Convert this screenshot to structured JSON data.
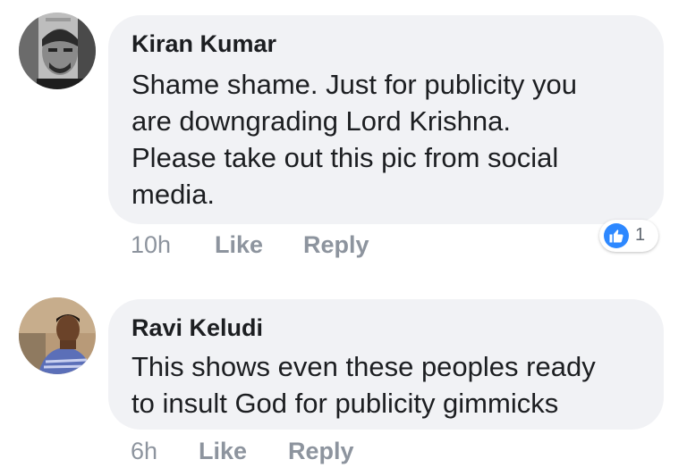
{
  "comments": [
    {
      "author": "Kiran Kumar",
      "lines": [
        "Shame shame. Just for publicity you",
        "are downgrading Lord Krishna.",
        "Please take out this pic from social",
        "media."
      ],
      "time": "10h",
      "like_label": "Like",
      "reply_label": "Reply",
      "reaction_count": "1",
      "reaction_icon": "thumbs-up-icon"
    },
    {
      "author": "Ravi Keludi",
      "lines": [
        "This shows even these peoples ready",
        "to insult God for publicity gimmicks"
      ],
      "time": "6h",
      "like_label": "Like",
      "reply_label": "Reply"
    }
  ],
  "colors": {
    "bubble_bg": "#f1f2f5",
    "meta_text": "#8d949e",
    "reaction_blue": "#2d88ff"
  }
}
